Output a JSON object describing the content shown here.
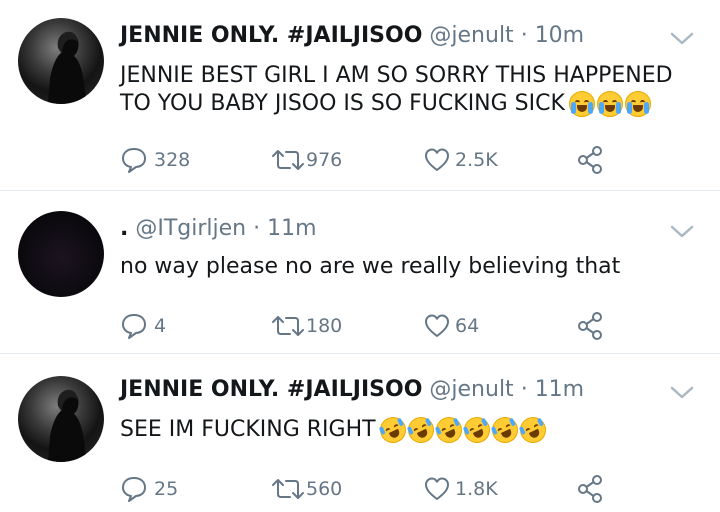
{
  "colors": {
    "secondary": "#657786",
    "divider": "#e6ecf0",
    "text": "#14171a"
  },
  "tweets": [
    {
      "name": "JENNIE ONLY. #JAILJISOO",
      "handle": "@jenult",
      "time": "10m",
      "separator": "·",
      "text": "JENNIE BEST GIRL I AM SO SORRY THIS HAPPENED\nTO YOU BABY JISOO IS SO FUCKING SICK",
      "emoji": "loudly-crying-face",
      "emoji_count": 3,
      "replies": "328",
      "retweets": "976",
      "likes": "2.5K"
    },
    {
      "name": ".",
      "handle": "@ITgirljen",
      "time": "11m",
      "separator": "·",
      "text": "no way please no are we really believing that",
      "replies": "4",
      "retweets": "180",
      "likes": "64"
    },
    {
      "name": "JENNIE ONLY. #JAILJISOO",
      "handle": "@jenult",
      "time": "11m",
      "separator": "·",
      "text": "SEE IM FUCKING RIGHT",
      "emoji": "rolling-on-floor-laughing",
      "emoji_count": 6,
      "replies": "25",
      "retweets": "560",
      "likes": "1.8K"
    }
  ]
}
